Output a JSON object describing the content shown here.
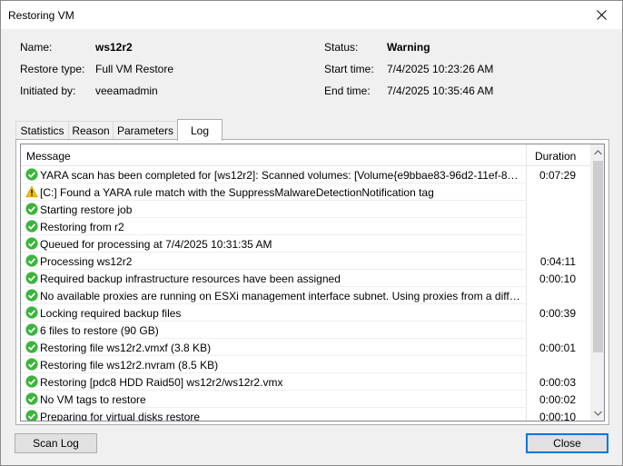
{
  "window": {
    "title": "Restoring VM"
  },
  "info": {
    "name_label": "Name:",
    "name_value": "ws12r2",
    "restore_type_label": "Restore type:",
    "restore_type_value": "Full VM Restore",
    "initiated_label": "Initiated by:",
    "initiated_value": "veeamadmin",
    "status_label": "Status:",
    "status_value": "Warning",
    "start_label": "Start time:",
    "start_value": "7/4/2025 10:23:26 AM",
    "end_label": "End time:",
    "end_value": "7/4/2025 10:35:46 AM"
  },
  "tabs": [
    {
      "label": "Statistics",
      "active": false
    },
    {
      "label": "Reason",
      "active": false
    },
    {
      "label": "Parameters",
      "active": false
    },
    {
      "label": "Log",
      "active": true
    }
  ],
  "log": {
    "col_message": "Message",
    "col_duration": "Duration",
    "rows": [
      {
        "icon": "success-check-icon",
        "message": "YARA scan has been completed for [ws12r2]: Scanned volumes: [Volume{e9bbae83-96d2-11ef-80b ...",
        "duration": "0:07:29"
      },
      {
        "icon": "warning-triangle-icon",
        "message": "[C:] Found a YARA rule match with the SuppressMalwareDetectionNotification tag",
        "duration": ""
      },
      {
        "icon": "success-check-icon",
        "message": "Starting restore job",
        "duration": ""
      },
      {
        "icon": "success-check-icon",
        "message": "Restoring from r2",
        "duration": ""
      },
      {
        "icon": "success-check-icon",
        "message": "Queued for processing at 7/4/2025 10:31:35 AM",
        "duration": ""
      },
      {
        "icon": "success-check-icon",
        "message": "Processing ws12r2",
        "duration": "0:04:11"
      },
      {
        "icon": "success-check-icon",
        "message": "Required backup infrastructure resources have been assigned",
        "duration": "0:00:10"
      },
      {
        "icon": "success-check-icon",
        "message": "No available proxies are running on ESXi management interface subnet. Using proxies from a differ...",
        "duration": ""
      },
      {
        "icon": "success-check-icon",
        "message": "Locking required backup files",
        "duration": "0:00:39"
      },
      {
        "icon": "success-check-icon",
        "message": "6 files to restore (90 GB)",
        "duration": ""
      },
      {
        "icon": "success-check-icon",
        "message": "Restoring file ws12r2.vmxf (3.8 KB)",
        "duration": "0:00:01"
      },
      {
        "icon": "success-check-icon",
        "message": "Restoring file ws12r2.nvram (8.5 KB)",
        "duration": ""
      },
      {
        "icon": "success-check-icon",
        "message": "Restoring [pdc8 HDD Raid50] ws12r2/ws12r2.vmx",
        "duration": "0:00:03"
      },
      {
        "icon": "success-check-icon",
        "message": "No VM tags to restore",
        "duration": "0:00:02"
      },
      {
        "icon": "success-check-icon",
        "message": "Preparing for virtual disks restore",
        "duration": "0:00:10"
      }
    ]
  },
  "buttons": {
    "scan_log": "Scan Log",
    "close": "Close"
  },
  "colors": {
    "success": "#3cb43c",
    "warning": "#f2c200",
    "accent": "#0078d7"
  }
}
